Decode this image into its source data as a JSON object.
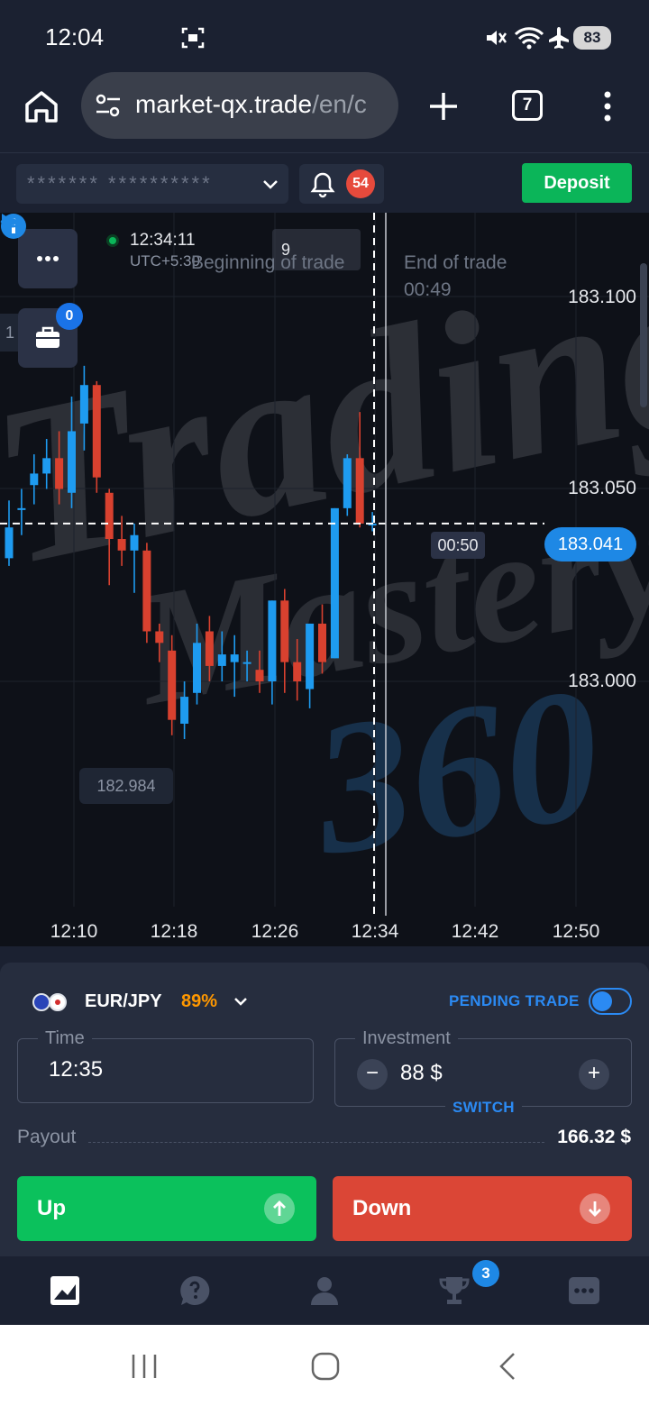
{
  "status_bar": {
    "time": "12:04",
    "battery": "83",
    "icons": [
      "screenshot-icon",
      "mute-icon",
      "wifi-icon",
      "airplane-icon",
      "battery-icon"
    ]
  },
  "browser": {
    "url_main": "market-qx.trade",
    "url_rest": "/en/c",
    "tab_count": "7"
  },
  "header": {
    "account_mask": "*******  **********",
    "notifications_count": "54",
    "deposit_label": "Deposit"
  },
  "chart": {
    "clock": "12:34:11",
    "timezone": "UTC+5:30",
    "signal_count": "9",
    "begin_label": "Beginning of trade",
    "end_label": "End of trade",
    "end_timer": "00:49",
    "left_cut_label": "1",
    "briefcase_count": "0",
    "countdown": "00:50",
    "current_price": "183.041",
    "low_price": "182.984",
    "watermark": [
      "Trading",
      "Mastery",
      "360"
    ],
    "colors": {
      "up": "#1e9bf0",
      "down": "#d8412f",
      "background": "#0e1118"
    }
  },
  "chart_data": {
    "type": "candlestick",
    "pair": "EUR/JPY",
    "price_ticks": [
      "183.100",
      "183.050",
      "183.000"
    ],
    "time_ticks": [
      "12:10",
      "12:18",
      "12:26",
      "12:34",
      "12:42",
      "12:50"
    ],
    "current_price": 183.041,
    "candles": [
      {
        "o": 183.032,
        "h": 183.047,
        "l": 183.03,
        "c": 183.04
      },
      {
        "o": 183.045,
        "h": 183.05,
        "l": 183.038,
        "c": 183.045
      },
      {
        "o": 183.051,
        "h": 183.059,
        "l": 183.046,
        "c": 183.054
      },
      {
        "o": 183.054,
        "h": 183.063,
        "l": 183.05,
        "c": 183.058
      },
      {
        "o": 183.058,
        "h": 183.065,
        "l": 183.046,
        "c": 183.05
      },
      {
        "o": 183.049,
        "h": 183.074,
        "l": 183.045,
        "c": 183.065
      },
      {
        "o": 183.067,
        "h": 183.082,
        "l": 183.06,
        "c": 183.077
      },
      {
        "o": 183.077,
        "h": 183.078,
        "l": 183.049,
        "c": 183.053
      },
      {
        "o": 183.049,
        "h": 183.05,
        "l": 183.025,
        "c": 183.037
      },
      {
        "o": 183.037,
        "h": 183.043,
        "l": 183.03,
        "c": 183.034
      },
      {
        "o": 183.034,
        "h": 183.041,
        "l": 183.023,
        "c": 183.038
      },
      {
        "o": 183.034,
        "h": 183.036,
        "l": 183.01,
        "c": 183.013
      },
      {
        "o": 183.013,
        "h": 183.015,
        "l": 183.005,
        "c": 183.01
      },
      {
        "o": 183.008,
        "h": 183.012,
        "l": 182.986,
        "c": 182.99
      },
      {
        "o": 182.989,
        "h": 183.0,
        "l": 182.985,
        "c": 182.996
      },
      {
        "o": 182.997,
        "h": 183.015,
        "l": 182.994,
        "c": 183.01
      },
      {
        "o": 183.013,
        "h": 183.017,
        "l": 183.0,
        "c": 183.004
      },
      {
        "o": 183.004,
        "h": 183.013,
        "l": 183.0,
        "c": 183.007
      },
      {
        "o": 183.005,
        "h": 183.012,
        "l": 182.996,
        "c": 183.007
      },
      {
        "o": 183.005,
        "h": 183.008,
        "l": 183.0,
        "c": 183.005
      },
      {
        "o": 183.003,
        "h": 183.008,
        "l": 182.997,
        "c": 183.0
      },
      {
        "o": 183.0,
        "h": 183.021,
        "l": 182.994,
        "c": 183.021
      },
      {
        "o": 183.021,
        "h": 183.024,
        "l": 182.997,
        "c": 183.005
      },
      {
        "o": 183.005,
        "h": 183.011,
        "l": 182.995,
        "c": 183.0
      },
      {
        "o": 182.998,
        "h": 183.015,
        "l": 182.993,
        "c": 183.015
      },
      {
        "o": 183.015,
        "h": 183.02,
        "l": 183.002,
        "c": 183.005
      },
      {
        "o": 183.006,
        "h": 183.045,
        "l": 183.006,
        "c": 183.045
      },
      {
        "o": 183.045,
        "h": 183.059,
        "l": 183.043,
        "c": 183.058
      },
      {
        "o": 183.058,
        "h": 183.07,
        "l": 183.04,
        "c": 183.041
      },
      {
        "o": 183.041,
        "h": 183.044,
        "l": 183.039,
        "c": 183.041
      }
    ]
  },
  "trade": {
    "pair": "EUR/JPY",
    "payout_pct": "89%",
    "pending_label": "PENDING TRADE",
    "time_legend": "Time",
    "time_value": "12:35",
    "investment_legend": "Investment",
    "investment_value": "88 $",
    "minus": "−",
    "plus": "+",
    "switch_label": "SWITCH",
    "payout_label": "Payout",
    "payout_value": "166.32 $",
    "up_label": "Up",
    "down_label": "Down"
  },
  "bottom_nav": {
    "items": [
      "chart-icon",
      "help-icon",
      "profile-icon",
      "trophy-icon",
      "chat-icon"
    ],
    "trophy_badge": "3"
  }
}
